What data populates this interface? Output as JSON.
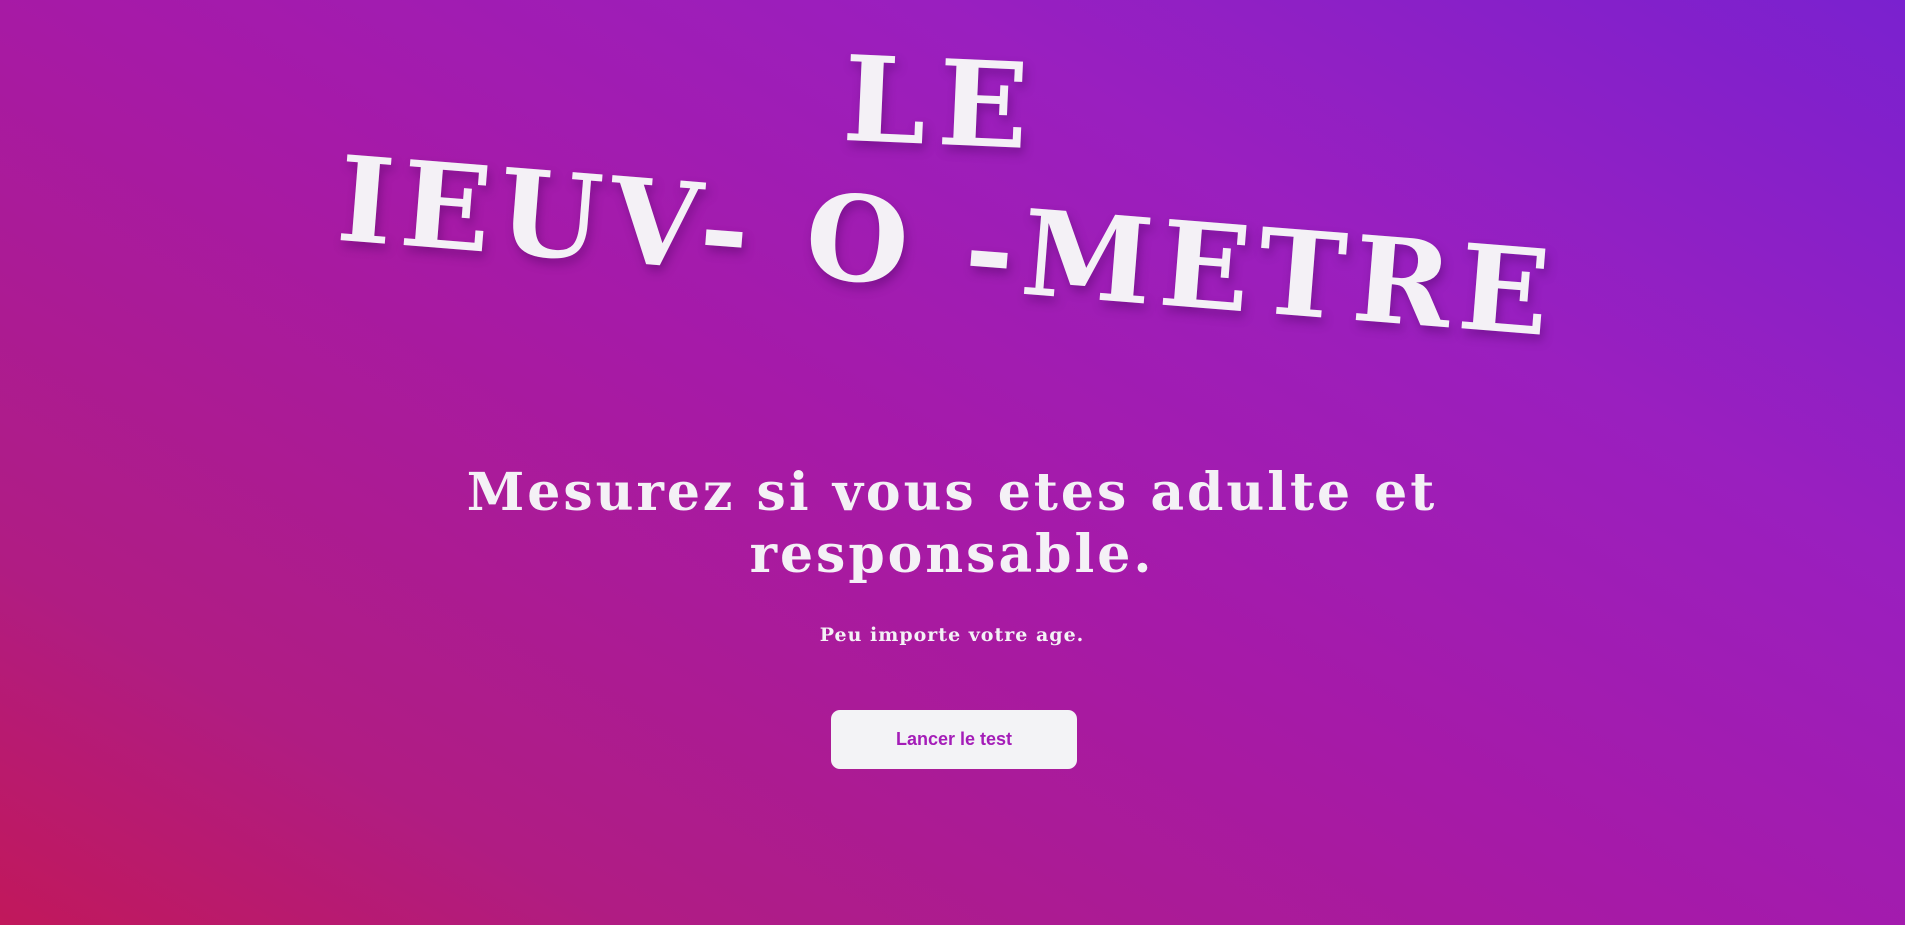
{
  "title": {
    "line1": "LE",
    "line2": "IEUV- O -METRE"
  },
  "headline": "Mesurez si vous etes adulte et responsable.",
  "subtitle": "Peu importe votre age.",
  "cta": {
    "label": "Lancer le test"
  },
  "colors": {
    "background_start": "#c1185b",
    "background_end": "#7a21cf",
    "text": "#f4f1f6",
    "button_bg": "#f3f3f6",
    "button_text": "#a41db8"
  }
}
